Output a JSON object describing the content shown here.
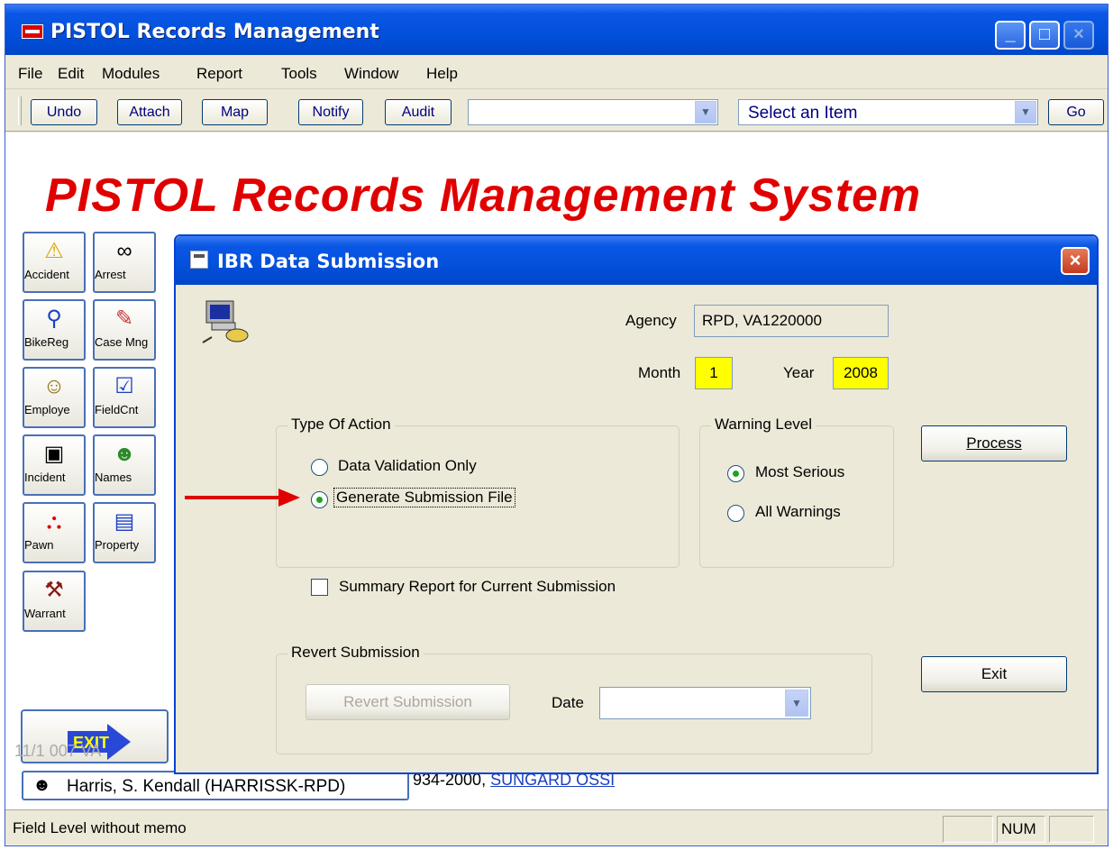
{
  "window": {
    "title": "PISTOL Records Management"
  },
  "menu": [
    "File",
    "Edit",
    "Modules",
    "Report",
    "Tools",
    "Window",
    "Help"
  ],
  "toolbar": {
    "buttons": [
      "Undo",
      "Attach",
      "Map",
      "Notify",
      "Audit"
    ],
    "combo1_value": "",
    "combo2_value": "Select an Item",
    "go_label": "Go"
  },
  "banner": "PISTOL Records Management System",
  "modules": [
    "Accident",
    "Arrest",
    "BikeReg",
    "Case Mng",
    "Employe",
    "FieldCnt",
    "Incident",
    "Names",
    "Pawn",
    "Property",
    "Warrant"
  ],
  "exit_label": "EXIT",
  "timestamp_partial": "11/1 007 VA",
  "user": {
    "name": "Harris, S. Kendall  (HARRISSK-RPD)",
    "phone_partial": "934-2000,",
    "link_partial": "SUNGARD OSSI"
  },
  "status": {
    "text": "Field Level without memo",
    "num": "NUM"
  },
  "dialog": {
    "title": "IBR Data Submission",
    "agency_label": "Agency",
    "agency_value": "RPD, VA1220000",
    "month_label": "Month",
    "month_value": "1",
    "year_label": "Year",
    "year_value": "2008",
    "type_of_action": {
      "title": "Type Of Action",
      "options": [
        "Data Validation Only",
        "Generate Submission File"
      ],
      "selected": "Generate Submission File"
    },
    "warning_level": {
      "title": "Warning Level",
      "options": [
        "Most Serious",
        "All Warnings"
      ],
      "selected": "Most Serious"
    },
    "summary_report_label": "Summary Report for Current Submission",
    "summary_report_checked": false,
    "process_label": "Process",
    "exit_label": "Exit",
    "revert": {
      "title": "Revert Submission",
      "button_label": "Revert Submission",
      "date_label": "Date",
      "date_value": ""
    }
  },
  "colors": {
    "banner": "#e00000",
    "highlight": "#ffff00",
    "titlebar": "#0250dc",
    "arrow": "#e00000"
  }
}
